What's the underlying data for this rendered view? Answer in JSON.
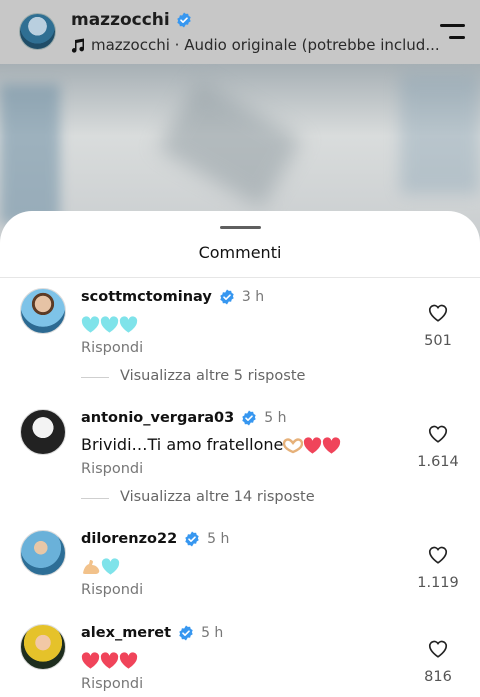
{
  "header": {
    "username": "mazzocchi",
    "audio_text": "mazzocchi · Audio originale (potrebbe includ..."
  },
  "sheet": {
    "title": "Commenti"
  },
  "comments": [
    {
      "username": "scottmctominay",
      "time": "3 h",
      "text": "",
      "emojis": [
        "light-blue-heart",
        "light-blue-heart",
        "light-blue-heart"
      ],
      "reply_label": "Rispondi",
      "likes": "501",
      "more_replies": "Visualizza altre 5 risposte"
    },
    {
      "username": "antonio_vergara03",
      "time": "5 h",
      "text": "Brividi…Ti amo fratellone",
      "emojis": [
        "heart-hands",
        "red-heart",
        "red-heart"
      ],
      "reply_label": "Rispondi",
      "likes": "1.614",
      "more_replies": "Visualizza altre 14 risposte"
    },
    {
      "username": "dilorenzo22",
      "time": "5 h",
      "text": "",
      "emojis": [
        "flexed-biceps",
        "light-blue-heart"
      ],
      "reply_label": "Rispondi",
      "likes": "1.119"
    },
    {
      "username": "alex_meret",
      "time": "5 h",
      "text": "",
      "emojis": [
        "red-heart",
        "red-heart",
        "red-heart"
      ],
      "reply_label": "Rispondi",
      "likes": "816"
    }
  ],
  "colors": {
    "verified": "#3797f0",
    "teal_heart": "#7fe3ea",
    "red_heart": "#f0445a",
    "muted_text": "#777777"
  },
  "icons": {
    "menu": "hamburger-menu-icon",
    "audio": "music-note-icon",
    "like": "heart-outline-icon",
    "verified": "verified-badge-icon"
  }
}
